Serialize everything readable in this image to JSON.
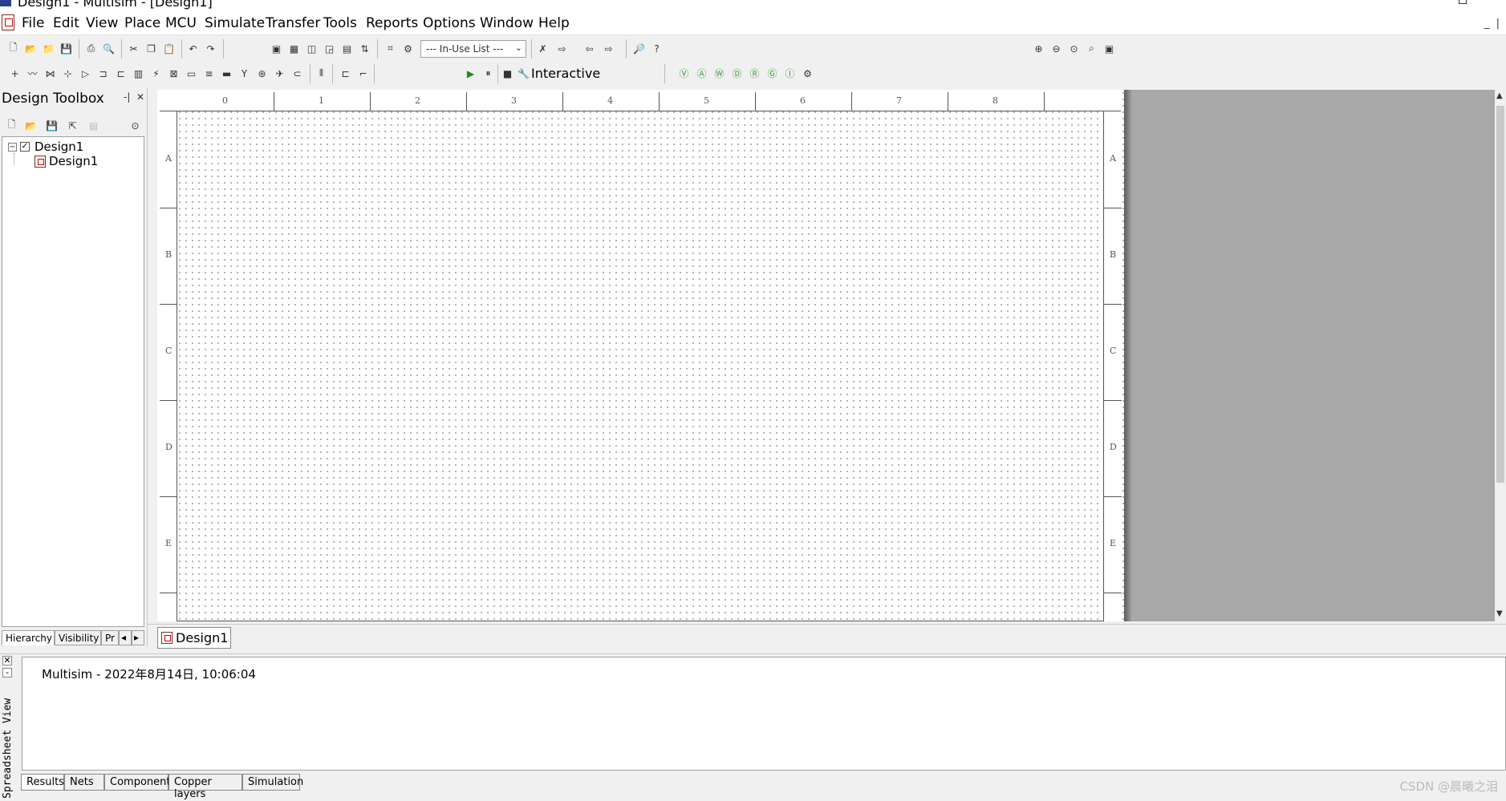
{
  "window": {
    "title": "Design1 - Multisim - [Design1]"
  },
  "menu": [
    "File",
    "Edit",
    "View",
    "Place",
    "MCU",
    "Simulate",
    "Transfer",
    "Tools",
    "Reports",
    "Options",
    "Window",
    "Help"
  ],
  "toolbar": {
    "in_use_list": "--- In-Use List ---",
    "sim_mode": "Interactive"
  },
  "toolbox": {
    "title": "Design Toolbox",
    "tree": {
      "root": "Design1",
      "child": "Design1"
    },
    "tabs": [
      "Hierarchy",
      "Visibility",
      "Pr"
    ]
  },
  "sheet": {
    "col_labels": [
      "0",
      "1",
      "2",
      "3",
      "4",
      "5",
      "6",
      "7",
      "8"
    ],
    "row_labels": [
      "A",
      "B",
      "C",
      "D",
      "E"
    ]
  },
  "doc_tab": "Design1",
  "spreadsheet": {
    "title": "Spreadsheet View",
    "message": "Multisim  -  2022年8月14日, 10:06:04",
    "tabs": [
      "Results",
      "Nets",
      "Components",
      "Copper layers",
      "Simulation"
    ]
  },
  "watermark": "CSDN @晨曦之泪"
}
